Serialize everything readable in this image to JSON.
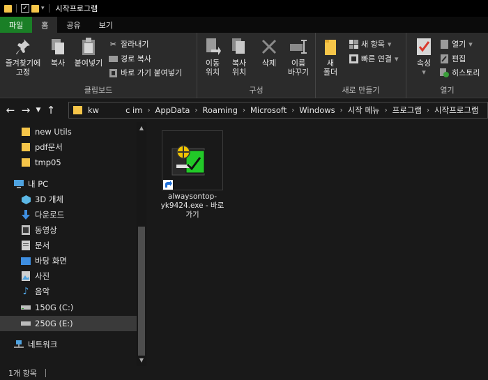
{
  "window": {
    "title": "시작프로그램"
  },
  "ribbon": {
    "tabs": [
      "파일",
      "홈",
      "공유",
      "보기"
    ],
    "clipboard": {
      "pin": "즐겨찾기에\n고정",
      "copy": "복사",
      "paste": "붙여넣기",
      "cut": "잘라내기",
      "copy_path": "경로 복사",
      "paste_shortcut": "바로 가기 붙여넣기",
      "caption": "클립보드"
    },
    "organize": {
      "move_to": "이동\n위치",
      "copy_to": "복사\n위치",
      "delete": "삭제",
      "rename": "이름\n바꾸기",
      "caption": "구성"
    },
    "new": {
      "new_folder": "새\n폴더",
      "new_item": "새 항목",
      "easy_access": "빠른 연결",
      "caption": "새로 만들기"
    },
    "open": {
      "properties": "속성",
      "open": "열기",
      "edit": "편집",
      "history": "히스토리",
      "caption": "열기"
    }
  },
  "address": {
    "path": [
      "kw",
      "c im",
      "AppData",
      "Roaming",
      "Microsoft",
      "Windows",
      "시작 메뉴",
      "프로그램",
      "시작프로그램"
    ]
  },
  "navpane": {
    "items": [
      {
        "label": "new Utils",
        "icon": "folder-icon"
      },
      {
        "label": "pdf문서",
        "icon": "folder-icon"
      },
      {
        "label": "tmp05",
        "icon": "folder-icon"
      },
      {
        "label": "내 PC",
        "icon": "pc-icon"
      },
      {
        "label": "3D 개체",
        "icon": "cube-icon"
      },
      {
        "label": "다운로드",
        "icon": "download-icon"
      },
      {
        "label": "동영상",
        "icon": "video-icon"
      },
      {
        "label": "문서",
        "icon": "document-icon"
      },
      {
        "label": "바탕 화면",
        "icon": "desktop-icon"
      },
      {
        "label": "사진",
        "icon": "picture-icon"
      },
      {
        "label": "음악",
        "icon": "music-icon"
      },
      {
        "label": "150G (C:)",
        "icon": "drive-icon"
      },
      {
        "label": "250G (E:)",
        "icon": "drive-icon"
      },
      {
        "label": "네트워크",
        "icon": "network-icon"
      }
    ]
  },
  "content": {
    "files": [
      {
        "name": "alwaysontop-yk9424.exe - 바로 가기",
        "icon": "shortcut-exe-icon"
      }
    ]
  },
  "status": {
    "count": "1개 항목"
  },
  "colors": {
    "file_tab": "#1a7f26",
    "folder": "#f6c549",
    "background": "#191919",
    "ribbon": "#2b2b2b"
  }
}
